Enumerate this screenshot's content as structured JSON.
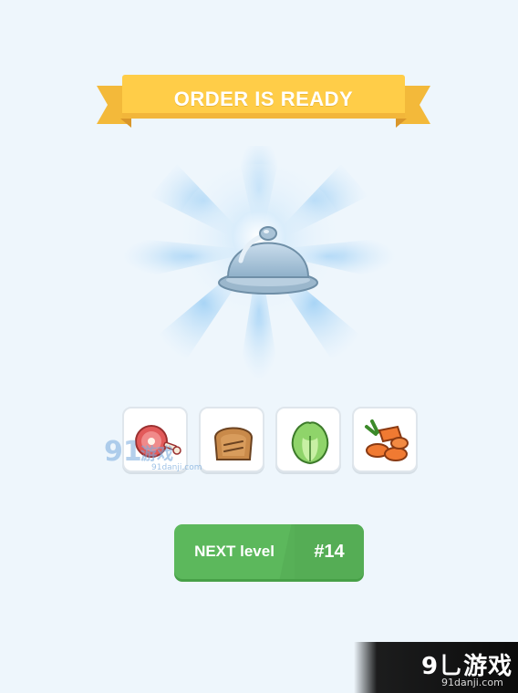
{
  "banner": {
    "title": "ORDER IS READY"
  },
  "result": {
    "dish_icon": "cloche-icon"
  },
  "ingredients": [
    {
      "name": "ham",
      "icon": "ham-icon"
    },
    {
      "name": "bread",
      "icon": "bread-icon"
    },
    {
      "name": "lettuce",
      "icon": "lettuce-icon"
    },
    {
      "name": "carrot",
      "icon": "carrot-icon"
    }
  ],
  "next_button": {
    "label": "NEXT level",
    "level": "#14"
  },
  "watermarks": {
    "overlay_number": "91",
    "overlay_text": "游戏",
    "overlay_url": "91danji.com",
    "corner_text": "9乚游戏",
    "corner_url": "91danji.com"
  },
  "colors": {
    "background": "#eef6fc",
    "banner": "#ffc944",
    "button": "#5cb85c"
  }
}
